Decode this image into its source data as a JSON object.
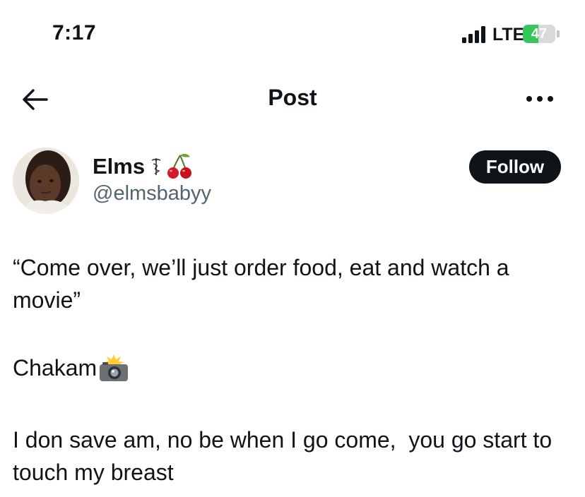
{
  "status_bar": {
    "time": "7:17",
    "network": "LTE",
    "battery_level": "47",
    "battery_color": "#34c759"
  },
  "header": {
    "title": "Post",
    "back_icon": "arrow-left-icon",
    "more_icon": "more-horizontal-icon"
  },
  "author": {
    "display_name": "Elms",
    "handle": "@elmsbabyy",
    "badge_icons": [
      "caduceus-icon",
      "cherries-icon"
    ],
    "follow_label": "Follow"
  },
  "post": {
    "paragraph_1": "“Come over, we’ll just order food, eat and watch a movie”",
    "paragraph_2": "Chakam",
    "paragraph_2_icon": "camera-flash-icon",
    "paragraph_3": "I don save am, no be when I go come,  you go start to touch my breast"
  },
  "colors": {
    "text_primary": "#0f1419",
    "text_secondary": "#536471",
    "follow_button_bg": "#0f1419"
  }
}
